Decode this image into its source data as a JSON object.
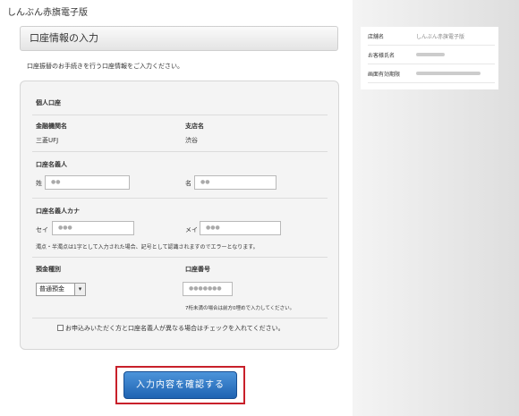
{
  "site": {
    "title": "しんぶん赤旗電子版"
  },
  "page": {
    "section_title": "口座情報の入力",
    "intro": "口座振替のお手続きを行う口座情報をご入力ください。"
  },
  "form": {
    "account_type_heading": "個人口座",
    "bank_label": "金融機関名",
    "bank_value": "三菱UFJ",
    "branch_label": "支店名",
    "branch_value": "渋谷",
    "holder_heading": "口座名義人",
    "sei_label": "姓",
    "sei_value": "●●",
    "mei_label": "名",
    "mei_value": "●●",
    "kana_heading": "口座名義人カナ",
    "kana_sei_label": "セイ",
    "kana_sei_value": "●●●",
    "kana_mei_label": "メイ",
    "kana_mei_value": "●●●",
    "kana_note": "濁点・半濁点は1字として入力された場合、記号として認識されますのでエラーとなります。",
    "deposit_type_label": "預金種別",
    "deposit_type_value": "普通預金",
    "account_number_label": "口座番号",
    "account_number_value": "●●●●●●●",
    "account_number_note": "7桁未満の場合は前方0埋めで入力してください。",
    "different_holder_check": "お申込みいただく方と口座名義人が異なる場合はチェックを入れてください。",
    "confirm_button": "入力内容を確認する"
  },
  "sidebar_info": {
    "store_label": "店舗名",
    "store_value": "しんぶん赤旗電子版",
    "customer_label": "お客様氏名",
    "expiry_label": "画面有効期限"
  }
}
